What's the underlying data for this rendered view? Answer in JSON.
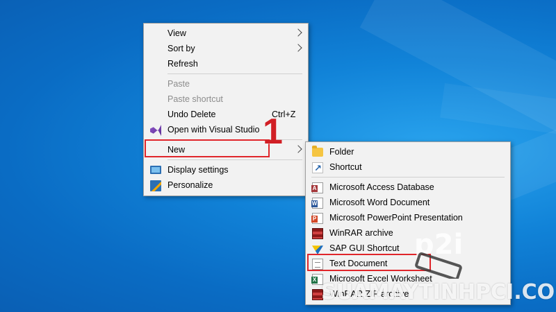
{
  "context_menu": {
    "items": [
      {
        "label": "View",
        "submenu": true
      },
      {
        "label": "Sort by",
        "submenu": true
      },
      {
        "label": "Refresh"
      },
      {
        "label": "Paste",
        "disabled": true
      },
      {
        "label": "Paste shortcut",
        "disabled": true
      },
      {
        "label": "Undo Delete",
        "shortcut": "Ctrl+Z"
      },
      {
        "label": "Open with Visual Studio",
        "icon": "visual-studio-icon"
      },
      {
        "label": "New",
        "submenu": true,
        "highlighted": true
      },
      {
        "label": "Display settings",
        "icon": "display-settings-icon"
      },
      {
        "label": "Personalize",
        "icon": "personalize-icon"
      }
    ]
  },
  "new_submenu": {
    "items": [
      {
        "label": "Folder",
        "icon": "folder-icon"
      },
      {
        "label": "Shortcut",
        "icon": "shortcut-icon"
      },
      {
        "label": "Microsoft Access Database",
        "icon": "access-icon"
      },
      {
        "label": "Microsoft Word Document",
        "icon": "word-icon"
      },
      {
        "label": "Microsoft PowerPoint Presentation",
        "icon": "powerpoint-icon"
      },
      {
        "label": "WinRAR archive",
        "icon": "winrar-icon"
      },
      {
        "label": "SAP GUI Shortcut",
        "icon": "sap-icon"
      },
      {
        "label": "Text Document",
        "icon": "text-document-icon",
        "highlighted": true
      },
      {
        "label": "Microsoft Excel Worksheet",
        "icon": "excel-icon"
      },
      {
        "label": "WinRAR ZIP archive",
        "icon": "winrar-zip-icon"
      }
    ]
  },
  "annotation": {
    "step_number": "1",
    "highlight_color": "#e0252a"
  },
  "watermark": {
    "text": "SUAMAYTINHPCI.COM",
    "logo_text": "p2i"
  },
  "colors": {
    "menu_bg": "#f2f2f2",
    "desktop_blue": "#1183d8"
  }
}
